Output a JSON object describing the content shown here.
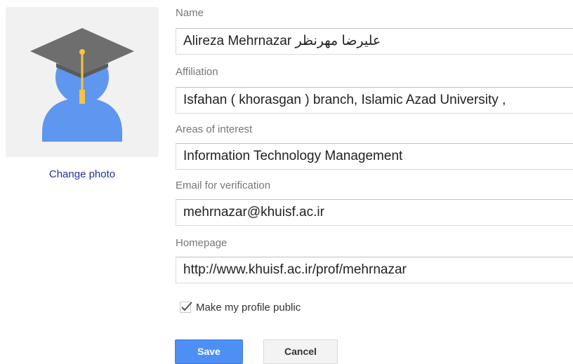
{
  "profile": {
    "change_photo_label": "Change photo",
    "photo_colors": {
      "background": "#f1f1f1",
      "person": "#5f96ef",
      "cap": "#6e6e6e",
      "tassel": "#f4c542"
    }
  },
  "form": {
    "name": {
      "label": "Name",
      "value": "Alireza Mehrnazar علیرضا مهرنظر"
    },
    "affiliation": {
      "label": "Affiliation",
      "value": "Isfahan ( khorasgan ) branch, Islamic Azad University ,"
    },
    "interests": {
      "label": "Areas of interest",
      "value": "Information Technology Management"
    },
    "email": {
      "label": "Email for verification",
      "value": "mehrnazar@khuisf.ac.ir"
    },
    "homepage": {
      "label": "Homepage",
      "value": "http://www.khuisf.ac.ir/prof/mehrnazar"
    },
    "public_checkbox": {
      "label": "Make my profile public",
      "checked": true
    }
  },
  "actions": {
    "save_label": "Save",
    "cancel_label": "Cancel",
    "save_color": "#4d8ff5"
  }
}
